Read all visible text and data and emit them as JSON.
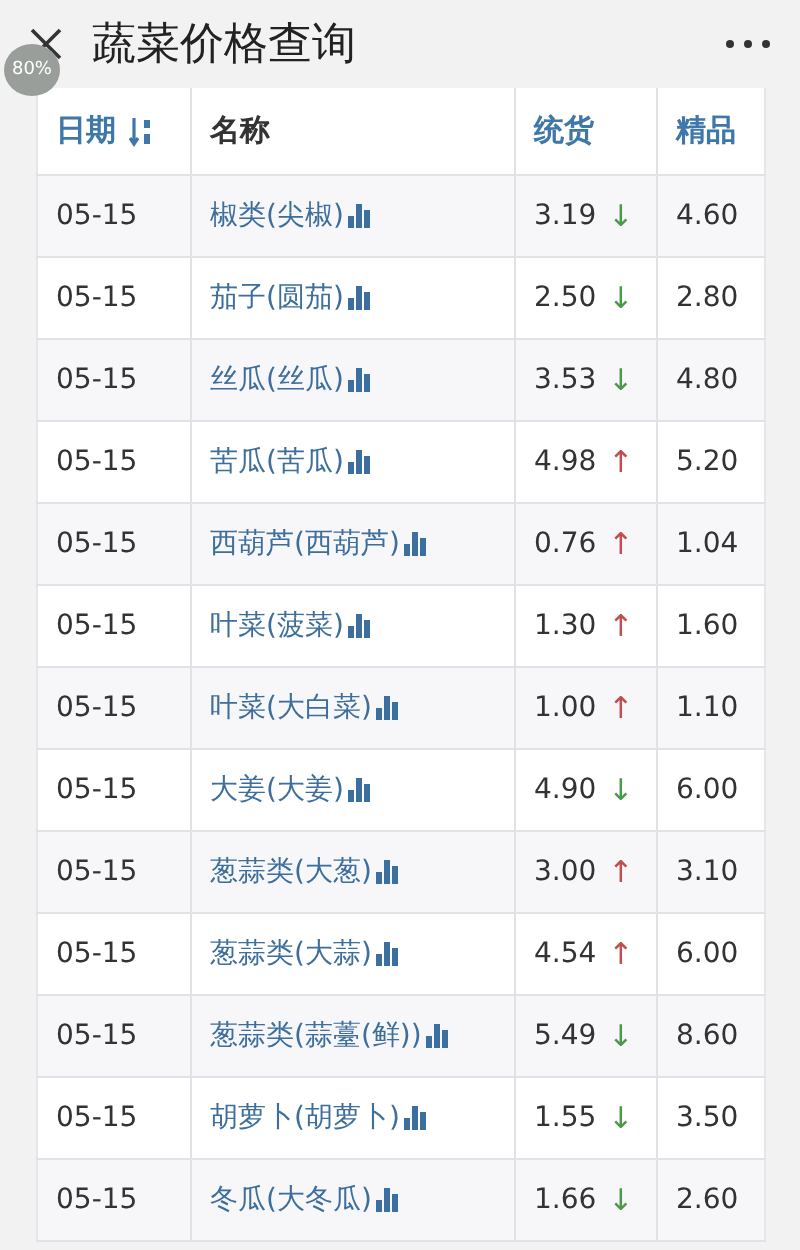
{
  "top_bar": {
    "title": "蔬菜价格查询",
    "zoom_badge": "80%"
  },
  "table": {
    "columns": [
      {
        "label": "日期",
        "sortable": true,
        "sorted": true
      },
      {
        "label": "名称",
        "sortable": false,
        "sorted": false
      },
      {
        "label": "统货",
        "sortable": true,
        "sorted": false
      },
      {
        "label": "精品",
        "sortable": true,
        "sorted": false
      }
    ],
    "rows": [
      {
        "date": "05-15",
        "name": "椒类(尖椒)",
        "bulk": "3.19",
        "arrow": "↓",
        "rising": false,
        "premium": "4.60"
      },
      {
        "date": "05-15",
        "name": "茄子(圆茄)",
        "bulk": "2.50",
        "arrow": "↓",
        "rising": false,
        "premium": "2.80"
      },
      {
        "date": "05-15",
        "name": "丝瓜(丝瓜)",
        "bulk": "3.53",
        "arrow": "↓",
        "rising": false,
        "premium": "4.80"
      },
      {
        "date": "05-15",
        "name": "苦瓜(苦瓜)",
        "bulk": "4.98",
        "arrow": "↑",
        "rising": true,
        "premium": "5.20"
      },
      {
        "date": "05-15",
        "name": "西葫芦(西葫芦)",
        "bulk": "0.76",
        "arrow": "↑",
        "rising": true,
        "premium": "1.04"
      },
      {
        "date": "05-15",
        "name": "叶菜(菠菜)",
        "bulk": "1.30",
        "arrow": "↑",
        "rising": true,
        "premium": "1.60"
      },
      {
        "date": "05-15",
        "name": "叶菜(大白菜)",
        "bulk": "1.00",
        "arrow": "↑",
        "rising": true,
        "premium": "1.10"
      },
      {
        "date": "05-15",
        "name": "大姜(大姜)",
        "bulk": "4.90",
        "arrow": "↓",
        "rising": false,
        "premium": "6.00"
      },
      {
        "date": "05-15",
        "name": "葱蒜类(大葱)",
        "bulk": "3.00",
        "arrow": "↑",
        "rising": true,
        "premium": "3.10"
      },
      {
        "date": "05-15",
        "name": "葱蒜类(大蒜)",
        "bulk": "4.54",
        "arrow": "↑",
        "rising": true,
        "premium": "6.00"
      },
      {
        "date": "05-15",
        "name": "葱蒜类(蒜薹(鲜))",
        "bulk": "5.49",
        "arrow": "↓",
        "rising": false,
        "premium": "8.60"
      },
      {
        "date": "05-15",
        "name": "胡萝卜(胡萝卜)",
        "bulk": "1.55",
        "arrow": "↓",
        "rising": false,
        "premium": "3.50"
      },
      {
        "date": "05-15",
        "name": "冬瓜(大冬瓜)",
        "bulk": "1.66",
        "arrow": "↓",
        "rising": false,
        "premium": "2.60"
      }
    ]
  }
}
